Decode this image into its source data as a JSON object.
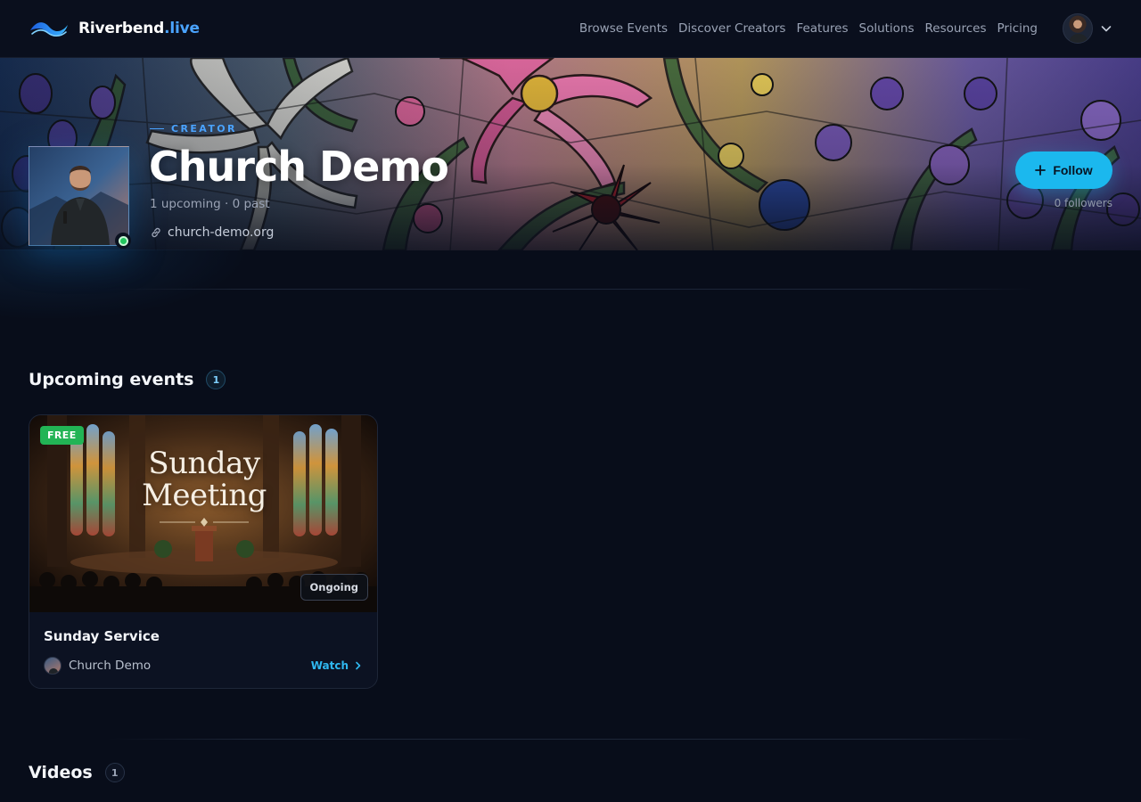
{
  "brand": {
    "name": "Riverbend",
    "tld": ".live"
  },
  "nav": {
    "links": [
      "Browse Events",
      "Discover Creators",
      "Features",
      "Solutions",
      "Resources",
      "Pricing"
    ]
  },
  "creator": {
    "kicker": "CREATOR",
    "name": "Church Demo",
    "stats": "1 upcoming · 0 past",
    "website": "church-demo.org",
    "follow_label": "Follow",
    "followers": "0 followers",
    "online": true
  },
  "upcoming": {
    "title": "Upcoming events",
    "count": "1",
    "events": [
      {
        "price_badge": "FREE",
        "thumb_title_line1": "Sunday",
        "thumb_title_line2": "Meeting",
        "status": "Ongoing",
        "name": "Sunday Service",
        "creator": "Church Demo",
        "action": "Watch"
      }
    ]
  },
  "videos": {
    "title": "Videos",
    "count": "1"
  },
  "colors": {
    "background": "#080d1a",
    "accent": "#1bb8ee",
    "brand_blue": "#4aa3ff",
    "free_green": "#22b455",
    "online_green": "#22c55e"
  },
  "icons": [
    "wave-logo-icon",
    "chevron-down-icon",
    "link-icon",
    "plus-icon",
    "chevron-right-icon"
  ]
}
